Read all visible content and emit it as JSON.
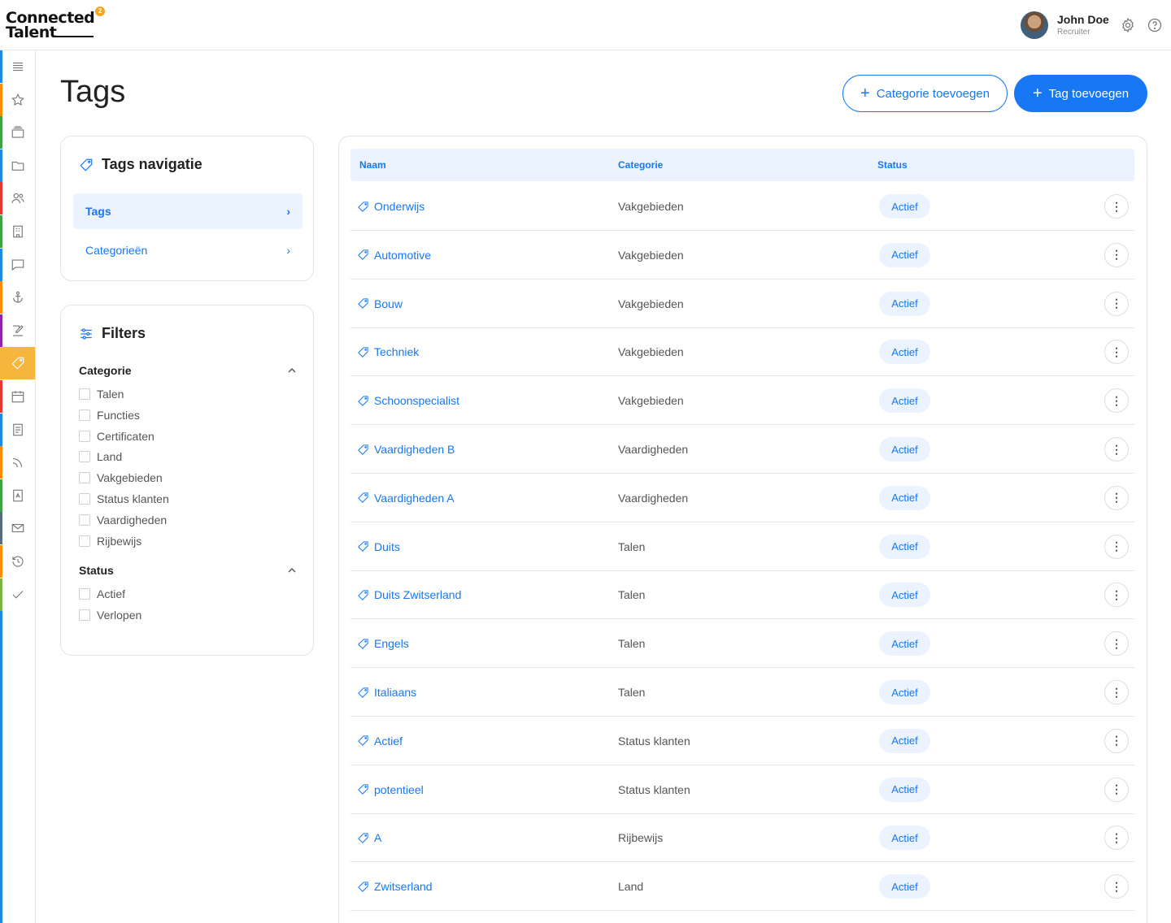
{
  "logo": {
    "line1": "Connected",
    "line2": "Talent",
    "badge": "2"
  },
  "user": {
    "name": "John Doe",
    "role": "Recruiter"
  },
  "page": {
    "title": "Tags"
  },
  "actions": {
    "add_category": "Categorie toevoegen",
    "add_tag": "Tag toevoegen"
  },
  "nav_card": {
    "title": "Tags navigatie",
    "items": [
      {
        "label": "Tags",
        "active": true
      },
      {
        "label": "Categorieën",
        "active": false
      }
    ]
  },
  "filters": {
    "title": "Filters",
    "categorie": {
      "label": "Categorie",
      "options": [
        "Talen",
        "Functies",
        "Certificaten",
        "Land",
        "Vakgebieden",
        "Status klanten",
        "Vaardigheden",
        "Rijbewijs"
      ]
    },
    "status": {
      "label": "Status",
      "options": [
        "Actief",
        "Verlopen"
      ]
    }
  },
  "table": {
    "columns": [
      "Naam",
      "Categorie",
      "Status"
    ],
    "rows": [
      {
        "name": "Onderwijs",
        "category": "Vakgebieden",
        "status": "Actief"
      },
      {
        "name": "Automotive",
        "category": "Vakgebieden",
        "status": "Actief"
      },
      {
        "name": "Bouw",
        "category": "Vakgebieden",
        "status": "Actief"
      },
      {
        "name": "Techniek",
        "category": "Vakgebieden",
        "status": "Actief"
      },
      {
        "name": "Schoonspecialist",
        "category": "Vakgebieden",
        "status": "Actief"
      },
      {
        "name": "Vaardigheden B",
        "category": "Vaardigheden",
        "status": "Actief"
      },
      {
        "name": "Vaardigheden A",
        "category": "Vaardigheden",
        "status": "Actief"
      },
      {
        "name": "Duits",
        "category": "Talen",
        "status": "Actief"
      },
      {
        "name": "Duits Zwitserland",
        "category": "Talen",
        "status": "Actief"
      },
      {
        "name": "Engels",
        "category": "Talen",
        "status": "Actief"
      },
      {
        "name": "Italiaans",
        "category": "Talen",
        "status": "Actief"
      },
      {
        "name": "Actief",
        "category": "Status klanten",
        "status": "Actief"
      },
      {
        "name": "potentieel",
        "category": "Status klanten",
        "status": "Actief"
      },
      {
        "name": "A",
        "category": "Rijbewijs",
        "status": "Actief"
      },
      {
        "name": "Zwitserland",
        "category": "Land",
        "status": "Actief"
      }
    ]
  },
  "rail": {
    "items": [
      "menu-icon",
      "star-icon",
      "layers-icon",
      "folder-icon",
      "users-icon",
      "building-icon",
      "chat-icon",
      "anchor-icon",
      "edit-icon",
      "tag-icon",
      "calendar-icon",
      "document-icon",
      "rss-icon",
      "pdf-icon",
      "mail-icon",
      "history-icon",
      "check-icon"
    ],
    "active": "tag-icon",
    "colors": [
      "#1e88e5",
      "#fb8c00",
      "#43a047",
      "#1e88e5",
      "#e53935",
      "#43a047",
      "#1e88e5",
      "#fb8c00",
      "#8e24aa",
      "#f6b53d",
      "#e53935",
      "#1e88e5",
      "#fb8c00",
      "#43a047",
      "#546e7a",
      "#fb8c00",
      "#7cb342"
    ]
  },
  "colors": {
    "accent": "#1877f2",
    "accent_light": "#eaf3ff",
    "active_rail": "#f6b53d"
  }
}
